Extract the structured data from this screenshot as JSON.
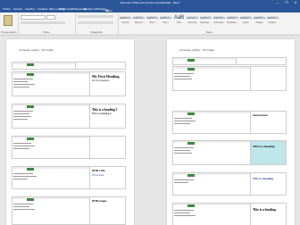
{
  "window": {
    "title": "Exercice HTML.docx [mode Compatibilité] - Word",
    "controls": [
      "—",
      "❐",
      "✕"
    ]
  },
  "menu": {
    "items": [
      "Fichier",
      "Accueil",
      "Insertion",
      "Création",
      "Mise en page",
      "Références",
      "Publipostage",
      "Révision",
      "Affichage"
    ],
    "tellme": "Dites-nous ce que vous voulez faire"
  },
  "ribbon": {
    "groups": [
      "Presse-papiers",
      "Police",
      "Paragraphe",
      "Styles"
    ],
    "styles": [
      {
        "sample": "AaBbCcI",
        "name": "Normal"
      },
      {
        "sample": "AaBbCcI",
        "name": "Sans int."
      },
      {
        "sample": "AaBbCc",
        "name": "Titre 1"
      },
      {
        "sample": "AaBbCc",
        "name": "Titre 2"
      },
      {
        "sample": "AaB",
        "name": "Titre"
      },
      {
        "sample": "AaBbCc",
        "name": "Sous-titre"
      },
      {
        "sample": "AaBbCcI",
        "name": "Emphase..."
      },
      {
        "sample": "AaBbCcI",
        "name": "Accentuat..."
      },
      {
        "sample": "AaBbCcI",
        "name": "Emphase..."
      },
      {
        "sample": "AaBbCcI",
        "name": "Élevé"
      },
      {
        "sample": "AaBbCcI",
        "name": "Citation"
      },
      {
        "sample": "AaBbCcI",
        "name": "Citation..."
      }
    ]
  },
  "pages": [
    {
      "header": "Computer coding - 7th Grade",
      "outputs": [
        {
          "heading": "",
          "sub": ""
        },
        {
          "heading": "My First Heading",
          "sub": "My first paragraph."
        },
        {
          "heading": "This is a heading 1",
          "sub": "This is a heading 2"
        },
        {
          "heading": "",
          "sub": ""
        },
        {
          "heading": "HTML Links",
          "sub": "This is a link"
        },
        {
          "heading": "HTML Images",
          "sub": ""
        }
      ]
    },
    {
      "header": "Computer coding - 7th Grade",
      "outputs": [
        {
          "heading": "",
          "sub": ""
        },
        {
          "heading": "",
          "sub": ""
        },
        {
          "heading": "Nested sections",
          "sub": ""
        },
        {
          "heading": "This is a heading",
          "sub": ""
        },
        {
          "heading": "This is a heading",
          "sub": ""
        },
        {
          "heading": "This is a heading",
          "sub": ""
        }
      ]
    }
  ]
}
